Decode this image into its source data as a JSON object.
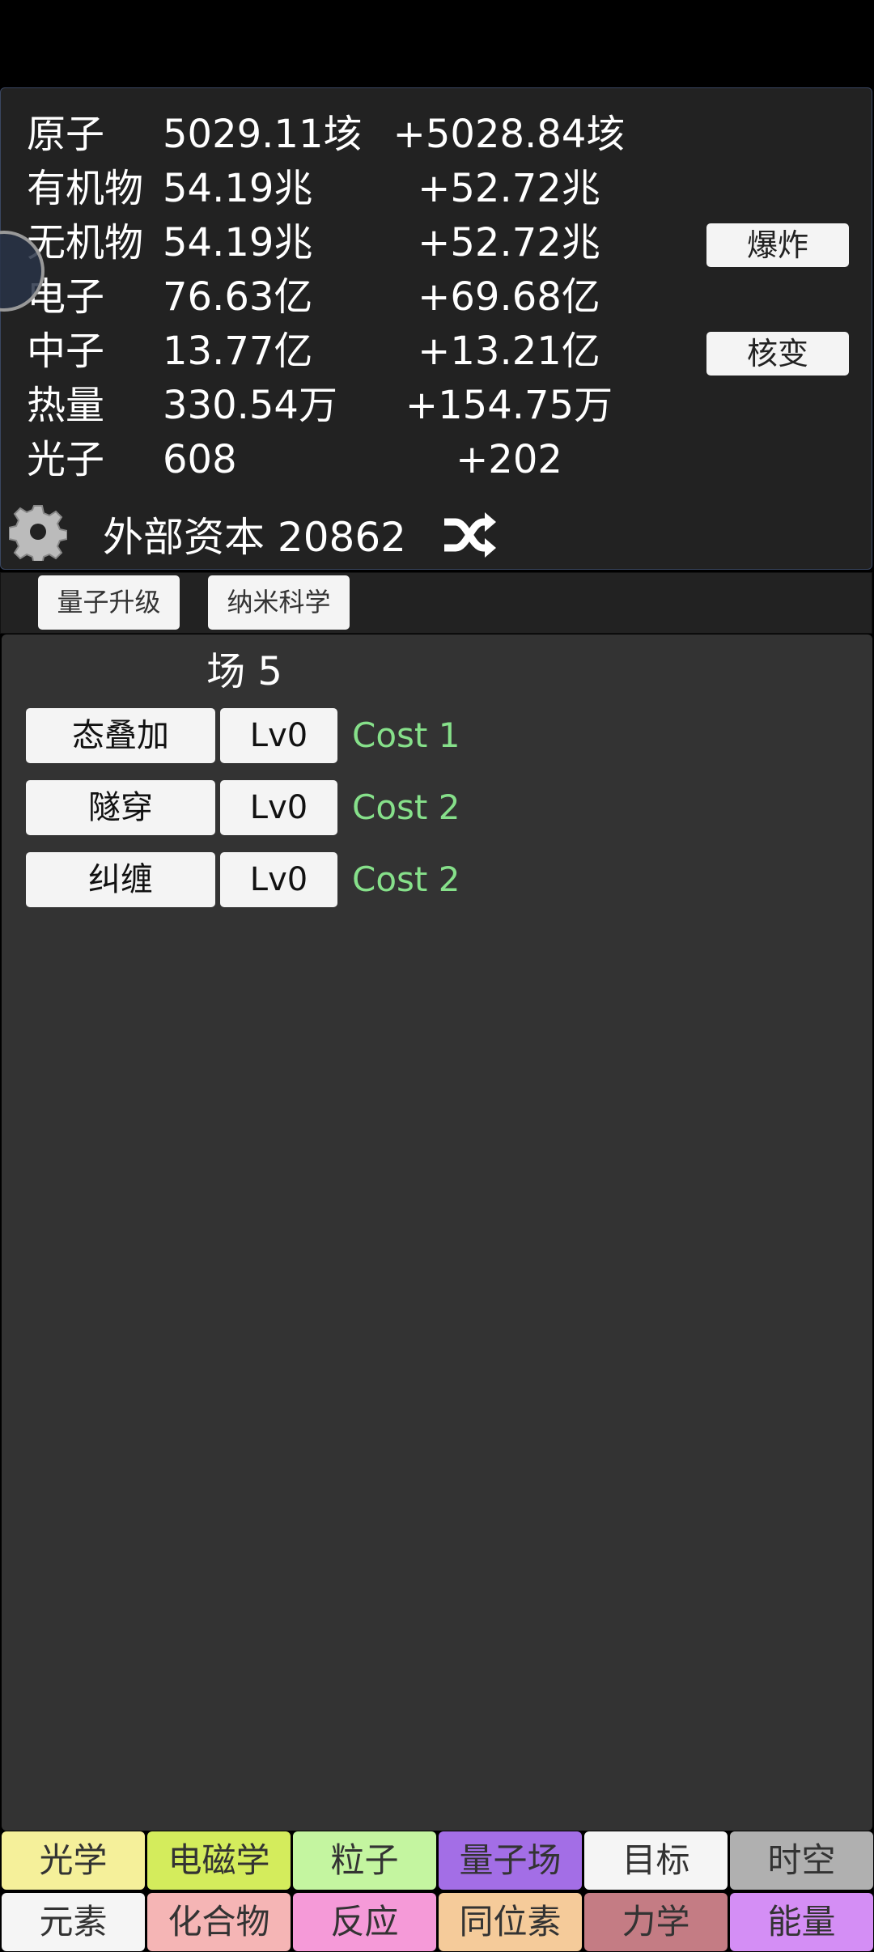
{
  "resources": [
    {
      "label": "原子",
      "value": "5029.11垓",
      "delta": "+5028.84垓"
    },
    {
      "label": "有机物",
      "value": "54.19兆",
      "delta": "+52.72兆"
    },
    {
      "label": "无机物",
      "value": "54.19兆",
      "delta": "+52.72兆"
    },
    {
      "label": "电子",
      "value": "76.63亿",
      "delta": "+69.68亿"
    },
    {
      "label": "中子",
      "value": "13.77亿",
      "delta": "+13.21亿"
    },
    {
      "label": "热量",
      "value": "330.54万",
      "delta": "+154.75万"
    },
    {
      "label": "光子",
      "value": "608",
      "delta": "+202"
    }
  ],
  "actions": {
    "explode": "爆炸",
    "fission": "核变"
  },
  "capital": {
    "text": "外部资本 20862",
    "icons": [
      "gear-icon",
      "shuffle-icon"
    ]
  },
  "subtabs": [
    "量子升级",
    "纳米科学"
  ],
  "field": {
    "title": "场 5",
    "upgrades": [
      {
        "name": "态叠加",
        "level": "Lv0",
        "cost": "Cost 1"
      },
      {
        "name": "隧穿",
        "level": "Lv0",
        "cost": "Cost 2"
      },
      {
        "name": "纠缠",
        "level": "Lv0",
        "cost": "Cost 2"
      }
    ],
    "cost_color": "#86e08a"
  },
  "nav": [
    {
      "label": "光学",
      "color": "#f5f09a"
    },
    {
      "label": "电磁学",
      "color": "#d4ec5c"
    },
    {
      "label": "粒子",
      "color": "#c4f5a0"
    },
    {
      "label": "量子场",
      "color": "#a36ee6"
    },
    {
      "label": "目标",
      "color": "#f5f5f5"
    },
    {
      "label": "时空",
      "color": "#b0b0b0"
    },
    {
      "label": "元素",
      "color": "#f5f5f5"
    },
    {
      "label": "化合物",
      "color": "#f5b5b5"
    },
    {
      "label": "反应",
      "color": "#f59ad8"
    },
    {
      "label": "同位素",
      "color": "#f5cb9a"
    },
    {
      "label": "力学",
      "color": "#c47c84"
    },
    {
      "label": "能量",
      "color": "#d48ef5"
    }
  ]
}
